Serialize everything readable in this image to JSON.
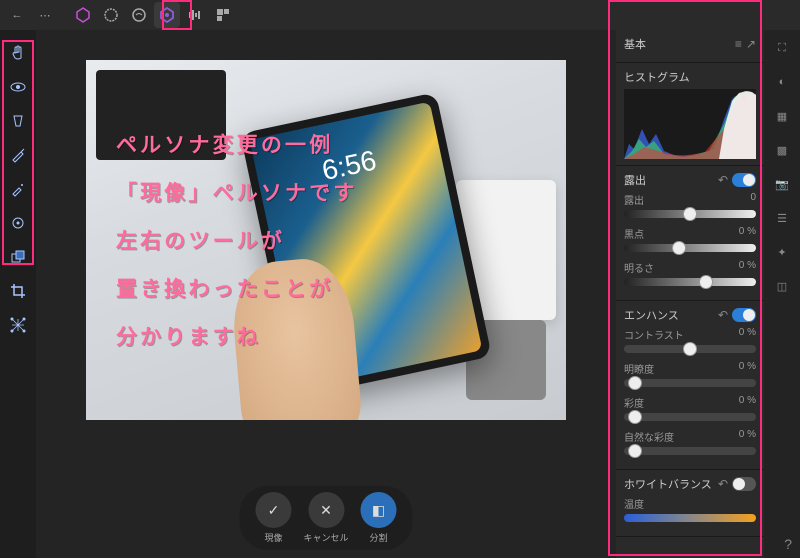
{
  "topbar": {
    "back_icon": "←",
    "more_icon": "⋯",
    "personas": [
      "affinity",
      "gear",
      "liquify",
      "develop",
      "tone",
      "export"
    ]
  },
  "left_tools": [
    "hand",
    "view",
    "redeye",
    "brush",
    "clone",
    "blemish",
    "gradient",
    "crop",
    "mesh"
  ],
  "canvas": {
    "ipad_time": "6:56"
  },
  "annotation": [
    "ペルソナ変更の一例",
    "「現像」ペルソナです",
    "左右のツールが",
    "置き換わったことが",
    "分かりますね"
  ],
  "bottom_actions": {
    "develop": {
      "label": "現像",
      "icon": "✓"
    },
    "cancel": {
      "label": "キャンセル",
      "icon": "✕"
    },
    "split": {
      "label": "分割",
      "icon": "◧"
    }
  },
  "panels": {
    "basic": {
      "title": "基本"
    },
    "histogram": {
      "title": "ヒストグラム"
    },
    "exposure": {
      "title": "露出",
      "sliders": {
        "exp": {
          "label": "露出",
          "value": "0",
          "pos": 50
        },
        "black": {
          "label": "黒点",
          "value": "0 %",
          "pos": 42
        },
        "bright": {
          "label": "明るさ",
          "value": "0 %",
          "pos": 62
        }
      }
    },
    "enhance": {
      "title": "エンハンス",
      "sliders": {
        "contrast": {
          "label": "コントラスト",
          "value": "0 %",
          "pos": 50
        },
        "clarity": {
          "label": "明瞭度",
          "value": "0 %",
          "pos": 8
        },
        "sat": {
          "label": "彩度",
          "value": "0 %",
          "pos": 8
        },
        "vib": {
          "label": "自然な彩度",
          "value": "0 %",
          "pos": 8
        }
      }
    },
    "wb": {
      "title": "ホワイトバランス",
      "temp_label": "温度"
    }
  },
  "right_icons": [
    "expand",
    "loupe",
    "swatch",
    "grid",
    "camera",
    "layers",
    "nav",
    "overlay"
  ],
  "help": "?"
}
